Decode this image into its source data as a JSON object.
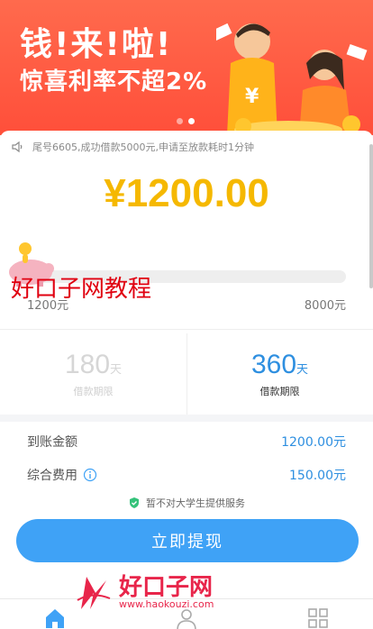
{
  "banner": {
    "headline": "钱!来!啦!",
    "subline": "惊喜利率不超2%",
    "dots": [
      false,
      true
    ]
  },
  "notice": {
    "text": "尾号6605,成功借款5000元,申请至放款耗时1分钟"
  },
  "loan": {
    "amount": "¥1200.00",
    "min": "1200元",
    "max": "8000元",
    "slider_fraction": 0
  },
  "watermark": {
    "text": "好口子网教程"
  },
  "periods": [
    {
      "num": "180",
      "unit": "天",
      "label": "借款期限",
      "selected": false
    },
    {
      "num": "360",
      "unit": "天",
      "label": "借款期限",
      "selected": true
    }
  ],
  "details": {
    "received_label": "到账金额",
    "received_value": "1200.00元",
    "fee_label": "综合费用",
    "fee_value": "150.00元"
  },
  "safety": {
    "text": "暂不对大学生提供服务"
  },
  "cta": {
    "label": "立即提现"
  },
  "logo": {
    "brand": "好口子网",
    "url": "www.haokouzi.com"
  },
  "colors": {
    "accent": "#3fa2f6",
    "amount": "#f5b800",
    "banner": "#ff5a40",
    "watermark": "#e00010"
  },
  "nav": [
    "home-icon",
    "user-icon",
    "grid-icon"
  ]
}
